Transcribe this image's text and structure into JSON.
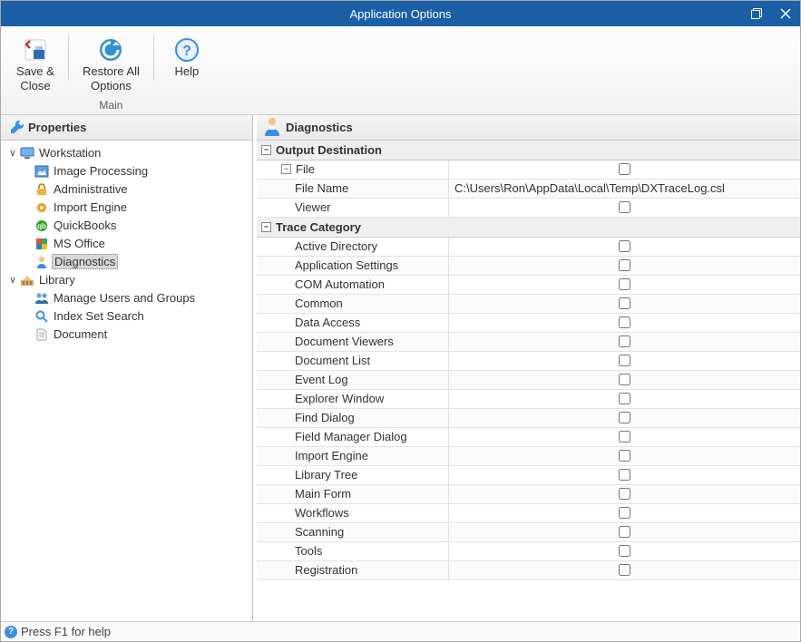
{
  "title": "Application Options",
  "ribbon": {
    "group_label": "Main",
    "save_close_l1": "Save &",
    "save_close_l2": "Close",
    "restore_l1": "Restore All",
    "restore_l2": "Options",
    "help": "Help"
  },
  "left_header": "Properties",
  "tree": {
    "workstation": "Workstation",
    "image_processing": "Image Processing",
    "administrative": "Administrative",
    "import_engine": "Import Engine",
    "quickbooks": "QuickBooks",
    "ms_office": "MS Office",
    "diagnostics": "Diagnostics",
    "library": "Library",
    "manage_users": "Manage Users and Groups",
    "index_set_search": "Index Set Search",
    "document": "Document"
  },
  "right_header": "Diagnostics",
  "categories": {
    "output_destination": "Output Destination",
    "trace_category": "Trace Category"
  },
  "rows": {
    "file": "File",
    "file_name": "File Name",
    "file_name_value": "C:\\Users\\Ron\\AppData\\Local\\Temp\\DXTraceLog.csl",
    "viewer": "Viewer",
    "active_directory": "Active Directory",
    "application_settings": "Application Settings",
    "com_automation": "COM Automation",
    "common": "Common",
    "data_access": "Data Access",
    "document_viewers": "Document Viewers",
    "document_list": "Document List",
    "event_log": "Event Log",
    "explorer_window": "Explorer Window",
    "find_dialog": "Find Dialog",
    "field_manager_dialog": "Field Manager Dialog",
    "import_engine": "Import Engine",
    "library_tree": "Library Tree",
    "main_form": "Main Form",
    "workflows": "Workflows",
    "scanning": "Scanning",
    "tools": "Tools",
    "registration": "Registration"
  },
  "statusbar": "Press F1 for help"
}
